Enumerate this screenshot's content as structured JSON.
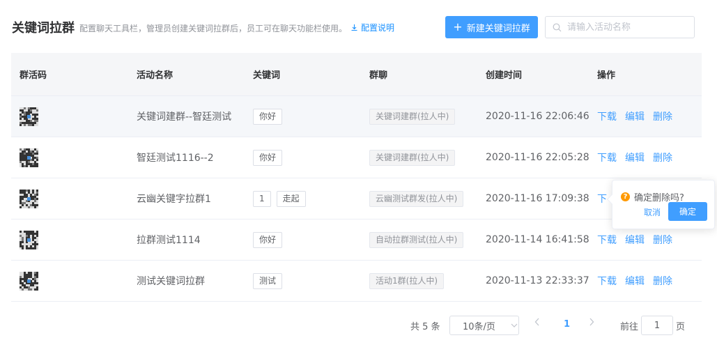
{
  "header": {
    "title": "关键词拉群",
    "description": "配置聊天工具栏，管理员创建关键词拉群后，员工可在聊天功能栏使用。",
    "doc_link": "配置说明",
    "new_button": "新建关键词拉群",
    "search_placeholder": "请输入活动名称"
  },
  "table": {
    "columns": [
      "群活码",
      "活动名称",
      "关键词",
      "群聊",
      "创建时间",
      "操作"
    ],
    "rows": [
      {
        "name": "关键词建群--智廷测试",
        "keywords": [
          "你好"
        ],
        "group": "关键词建群(拉人中)",
        "created": "2020-11-16 22:06:46"
      },
      {
        "name": "智廷测试1116--2",
        "keywords": [
          "你好"
        ],
        "group": "关键词建群(拉人中)",
        "created": "2020-11-16 22:05:28"
      },
      {
        "name": "云幽关键字拉群1",
        "keywords": [
          "1",
          "走起"
        ],
        "group": "云幽测试群发(拉人中)",
        "created": "2020-11-16 17:09:38"
      },
      {
        "name": "拉群测试1114",
        "keywords": [
          "你好"
        ],
        "group": "自动拉群测试(拉人中)",
        "created": "2020-11-14 16:41:58"
      },
      {
        "name": "测试关键词拉群",
        "keywords": [
          "测试"
        ],
        "group": "活动1群(拉人中)",
        "created": "2020-11-13 22:33:37"
      }
    ],
    "actions": {
      "download": "下载",
      "edit": "编辑",
      "delete": "删除"
    },
    "partial_action": "下"
  },
  "pagination": {
    "total": "共 5 条",
    "page_size": "10条/页",
    "current_page": "1",
    "goto_label": "前往",
    "goto_value": "1",
    "goto_suffix": "页"
  },
  "popconfirm": {
    "message": "确定删除吗?",
    "cancel": "取消",
    "confirm": "确定"
  },
  "colors": {
    "primary": "#409eff",
    "warning": "#ff9900"
  }
}
